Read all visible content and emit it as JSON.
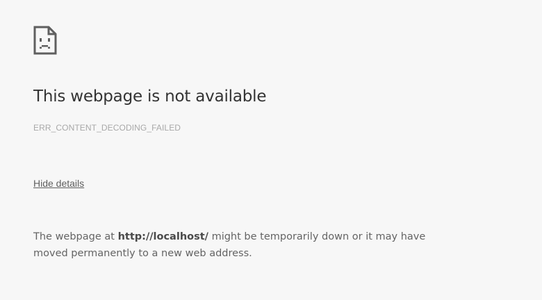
{
  "error": {
    "icon": "sad-page-icon",
    "title": "This webpage is not available",
    "code": "ERR_CONTENT_DECODING_FAILED",
    "details_toggle_label": "Hide details",
    "details": {
      "prefix": "The webpage at ",
      "url": "http://localhost/",
      "suffix": " might be temporarily down or it may have moved permanently to a new web address."
    }
  },
  "colors": {
    "background": "#f7f7f7",
    "title": "#333333",
    "code": "#a8a8a8",
    "body_text": "#646464"
  }
}
